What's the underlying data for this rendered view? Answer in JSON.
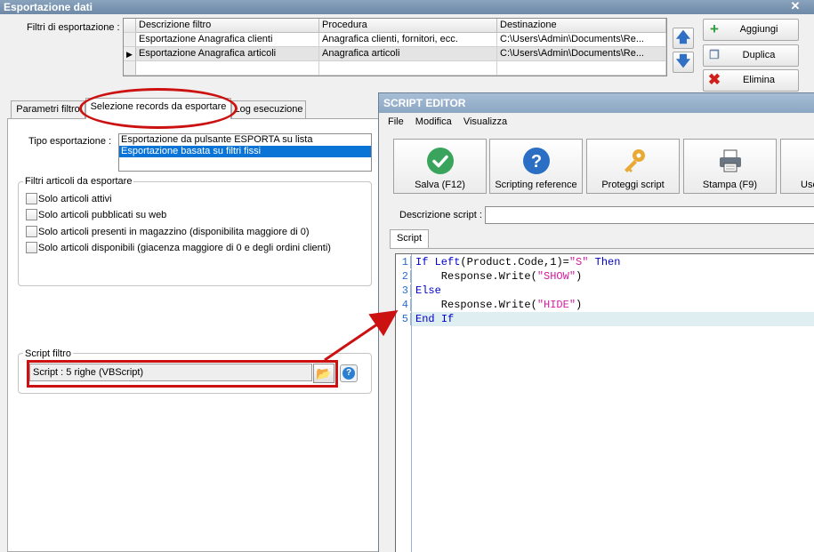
{
  "window": {
    "title": "Esportazione dati",
    "close_glyph": "✕"
  },
  "filters": {
    "label": "Filtri di esportazione :",
    "columns": [
      "Descrizione filtro",
      "Procedura",
      "Destinazione"
    ],
    "rows": [
      {
        "descrizione": "Esportazione Anagrafica clienti",
        "procedura": "Anagrafica clienti, fornitori, ecc.",
        "destinazione": "C:\\Users\\Admin\\Documents\\Re...",
        "current": false
      },
      {
        "descrizione": "Esportazione Anagrafica articoli",
        "procedura": "Anagrafica articoli",
        "destinazione": "C:\\Users\\Admin\\Documents\\Re...",
        "current": true
      }
    ]
  },
  "side_buttons": {
    "add": "Aggiungi",
    "duplicate": "Duplica",
    "delete": "Elimina"
  },
  "tabs": [
    "Parametri filtro",
    "Selezione records da esportare",
    "Log esecuzione"
  ],
  "active_tab": 1,
  "tipo": {
    "label": "Tipo esportazione :",
    "options": [
      "Esportazione da pulsante ESPORTA su lista",
      "Esportazione basata su filtri fissi"
    ],
    "selected_index": 1
  },
  "filtri_articoli": {
    "title": "Filtri articoli da esportare",
    "options": [
      "Solo articoli attivi",
      "Solo articoli pubblicati su web",
      "Solo articoli presenti in magazzino (disponibilita maggiore di 0)",
      "Solo articoli disponibili (giacenza maggiore di 0 e degli ordini clienti)"
    ]
  },
  "script_filtro": {
    "title": "Script filtro",
    "value": "Script : 5 righe (VBScript)"
  },
  "script_editor": {
    "title": "SCRIPT EDITOR",
    "menu": [
      "File",
      "Modifica",
      "Visualizza"
    ],
    "toolbar": [
      "Salva (F12)",
      "Scripting reference",
      "Proteggi script",
      "Stampa (F9)",
      "Usc"
    ],
    "desc_label": "Descrizione script :",
    "tab": "Script",
    "line_numbers": [
      "1",
      "2",
      "3",
      "4",
      "5"
    ],
    "code": {
      "l1": {
        "kw1": "If",
        "fn": "Left",
        "mid": "(Product.Code,1)=",
        "str": "\"S\"",
        "kw2": "Then"
      },
      "l2": {
        "text": "    Response.Write(",
        "str": "\"SHOW\"",
        "end": ")"
      },
      "l3": {
        "kw": "Else"
      },
      "l4": {
        "text": "    Response.Write(",
        "str": "\"HIDE\"",
        "end": ")"
      },
      "l5": {
        "text": "End ",
        "kw": "If"
      }
    }
  },
  "colors": {
    "annotation_red": "#cc1111",
    "selection_blue": "#0a74d6",
    "keyword_blue": "#0000cc",
    "string_magenta": "#d41ba0"
  }
}
